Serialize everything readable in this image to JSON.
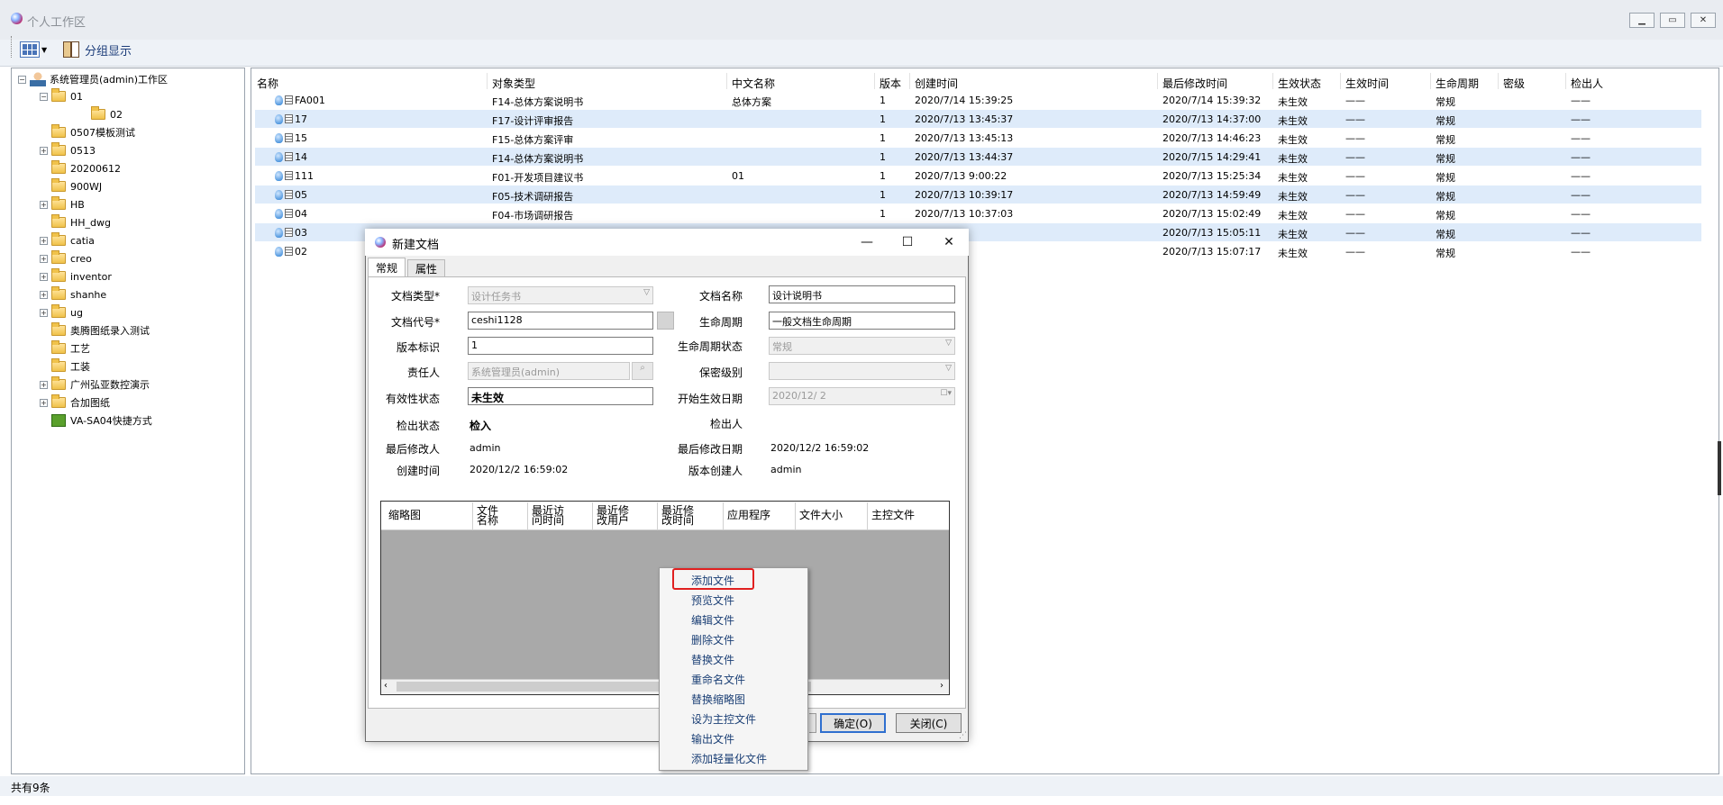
{
  "window": {
    "title": "个人工作区"
  },
  "toolbar": {
    "group_label": "分组显示"
  },
  "tree": {
    "root": "系统管理员(admin)工作区",
    "items": [
      "01",
      "02",
      "0507模板测试",
      "0513",
      "20200612",
      "900WJ",
      "HB",
      "HH_dwg",
      "catia",
      "creo",
      "inventor",
      "shanhe",
      "ug",
      "奥腾图纸录入测试",
      "工艺",
      "工装",
      "广州弘亚数控演示",
      "合加图纸",
      "VA-SA04快捷方式"
    ]
  },
  "grid": {
    "columns": [
      "名称",
      "对象类型",
      "中文名称",
      "版本",
      "创建时间",
      "最后修改时间",
      "生效状态",
      "生效时间",
      "生命周期",
      "密级",
      "检出人"
    ],
    "rows": [
      [
        "FA001",
        "F14-总体方案说明书",
        "总体方案",
        "1",
        "2020/7/14 15:39:25",
        "2020/7/14 15:39:32",
        "未生效",
        "——",
        "常规",
        "",
        "——"
      ],
      [
        "17",
        "F17-设计评审报告",
        "",
        "1",
        "2020/7/13 13:45:37",
        "2020/7/13 14:37:00",
        "未生效",
        "——",
        "常规",
        "",
        "——"
      ],
      [
        "15",
        "F15-总体方案评审",
        "",
        "1",
        "2020/7/13 13:45:13",
        "2020/7/13 14:46:23",
        "未生效",
        "——",
        "常规",
        "",
        "——"
      ],
      [
        "14",
        "F14-总体方案说明书",
        "",
        "1",
        "2020/7/13 13:44:37",
        "2020/7/15 14:29:41",
        "未生效",
        "——",
        "常规",
        "",
        "——"
      ],
      [
        "111",
        "F01-开发项目建议书",
        "01",
        "1",
        "2020/7/13 9:00:22",
        "2020/7/13 15:25:34",
        "未生效",
        "——",
        "常规",
        "",
        "——"
      ],
      [
        "05",
        "F05-技术调研报告",
        "",
        "1",
        "2020/7/13 10:39:17",
        "2020/7/13 14:59:49",
        "未生效",
        "——",
        "常规",
        "",
        "——"
      ],
      [
        "04",
        "F04-市场调研报告",
        "",
        "1",
        "2020/7/13 10:37:03",
        "2020/7/13 15:02:49",
        "未生效",
        "——",
        "常规",
        "",
        "——"
      ],
      [
        "03",
        "",
        "",
        "",
        "10:35:45",
        "2020/7/13 15:05:11",
        "未生效",
        "——",
        "常规",
        "",
        "——"
      ],
      [
        "02",
        "",
        "",
        "",
        "10:04:57",
        "2020/7/13 15:07:17",
        "未生效",
        "——",
        "常规",
        "",
        "——"
      ]
    ]
  },
  "status": {
    "count": "共有9条"
  },
  "dialog": {
    "title": "新建文档",
    "tabs": [
      "常规",
      "属性"
    ],
    "labels": {
      "doc_type": "文档类型*",
      "doc_code": "文档代号*",
      "version": "版本标识",
      "owner": "责任人",
      "validity": "有效性状态",
      "checkout_state": "检出状态",
      "last_modifier": "最后修改人",
      "created": "创建时间",
      "doc_name": "文档名称",
      "lifecycle": "生命周期",
      "lifecycle_state": "生命周期状态",
      "secret": "保密级别",
      "start_date": "开始生效日期",
      "checkout_person": "检出人",
      "last_modified": "最后修改日期",
      "version_creator": "版本创建人"
    },
    "values": {
      "doc_type": "设计任务书",
      "doc_code": "ceshi1128",
      "version": "1",
      "owner": "系统管理员(admin)",
      "validity": "未生效",
      "checkout_state": "检入",
      "last_modifier": "admin",
      "created": "2020/12/2 16:59:02",
      "doc_name": "设计说明书",
      "lifecycle": "一般文档生命周期",
      "lifecycle_state": "常规",
      "secret": "",
      "start_date": "2020/12/ 2",
      "checkout_person": "",
      "last_modified": "2020/12/2 16:59:02",
      "version_creator": "admin"
    },
    "file_columns": [
      "缩略图",
      "文件\n名称",
      "最近访\n问时间",
      "最近修\n改用户",
      "最近修\n改时间",
      "应用程序",
      "文件大小",
      "主控文件"
    ],
    "ok": "确定(O)",
    "close": "关闭(C)"
  },
  "context_menu": [
    "添加文件",
    "预览文件",
    "编辑文件",
    "删除文件",
    "替换文件",
    "重命名文件",
    "替换缩略图",
    "设为主控文件",
    "输出文件",
    "添加轻量化文件"
  ],
  "colors": {
    "row_alt": "#deebfa",
    "highlight": "#e02020",
    "ok_border": "#2f6fcf"
  }
}
